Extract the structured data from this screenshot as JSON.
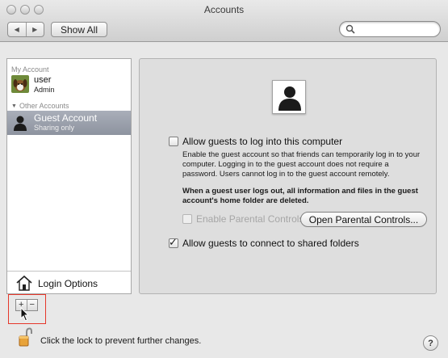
{
  "window": {
    "title": "Accounts"
  },
  "toolbar": {
    "back_label": "◀",
    "forward_label": "▶",
    "show_all_label": "Show All",
    "search_placeholder": ""
  },
  "sidebar": {
    "my_account_header": "My Account",
    "user": {
      "name": "user",
      "role": "Admin"
    },
    "other_accounts_header": "Other Accounts",
    "guest": {
      "name": "Guest Account",
      "status": "Sharing only"
    },
    "login_options_label": "Login Options",
    "add_label": "+",
    "remove_label": "−"
  },
  "main": {
    "allow_login": {
      "label": "Allow guests to log into this computer",
      "checked": false
    },
    "description": "Enable the guest account so that friends can temporarily log in to your computer. Logging in to the guest account does not require a password. Users cannot log in to the guest account remotely.",
    "warning": "When a guest user logs out, all information and files in the guest account's home folder are deleted.",
    "parental_controls": {
      "label": "Enable Parental Controls",
      "checked": false,
      "enabled": false
    },
    "open_parental_button": "Open Parental Controls...",
    "allow_shared": {
      "label": "Allow guests to connect to shared folders",
      "checked": true
    }
  },
  "footer": {
    "lock_text": "Click the lock to prevent further changes.",
    "help_label": "?"
  },
  "colors": {
    "selection": "#9aa0ab",
    "highlight_box": "#e5372b"
  }
}
